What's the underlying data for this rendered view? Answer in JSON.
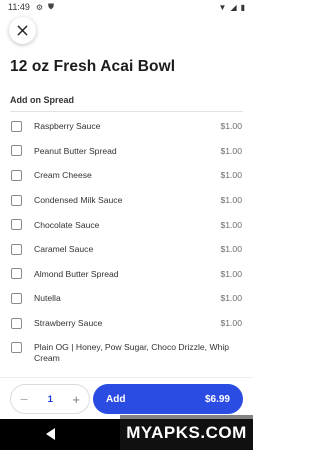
{
  "status": {
    "time": "11:49",
    "icons": [
      "gear-icon",
      "shield-icon",
      "wifi-icon",
      "signal-icon",
      "battery-icon"
    ]
  },
  "product": {
    "title": "12 oz Fresh Acai Bowl"
  },
  "section": {
    "header": "Add on Spread",
    "options": [
      {
        "label": "Raspberry Sauce",
        "price": "$1.00",
        "checked": false
      },
      {
        "label": "Peanut Butter Spread",
        "price": "$1.00",
        "checked": false
      },
      {
        "label": "Cream Cheese",
        "price": "$1.00",
        "checked": false
      },
      {
        "label": "Condensed Milk Sauce",
        "price": "$1.00",
        "checked": false
      },
      {
        "label": "Chocolate Sauce",
        "price": "$1.00",
        "checked": false
      },
      {
        "label": "Caramel Sauce",
        "price": "$1.00",
        "checked": false
      },
      {
        "label": "Almond Butter Spread",
        "price": "$1.00",
        "checked": false
      },
      {
        "label": "Nutella",
        "price": "$1.00",
        "checked": false
      },
      {
        "label": "Strawberry Sauce",
        "price": "$1.00",
        "checked": false
      },
      {
        "label": "Plain OG | Honey, Pow Sugar, Choco Drizzle, Whip Cream",
        "price": "",
        "checked": false
      }
    ]
  },
  "cart": {
    "minus": "−",
    "quantity": "1",
    "plus": "+",
    "add_label": "Add",
    "total": "$6.99"
  },
  "watermark": {
    "text": "MYAPKS.COM"
  },
  "colors": {
    "accent": "#2b4ce2",
    "nav": "#000000"
  }
}
